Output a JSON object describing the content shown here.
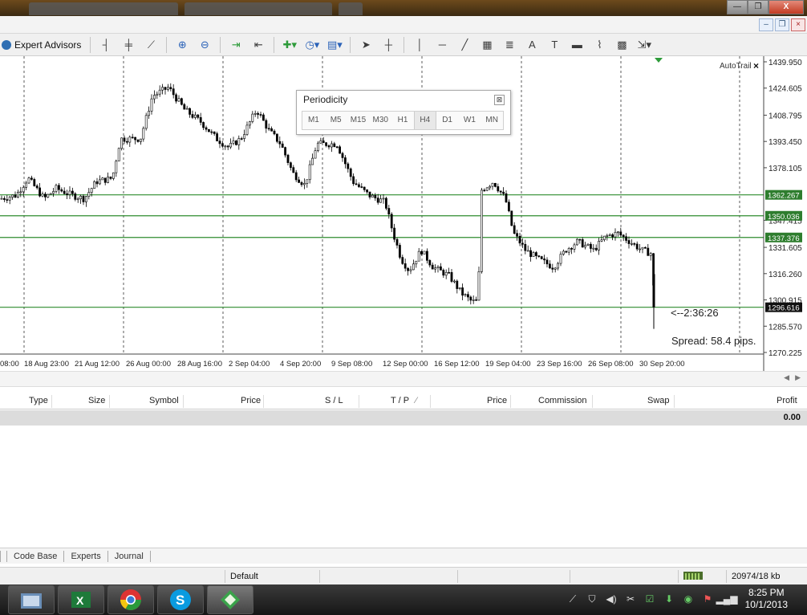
{
  "window": {
    "minimize": "—",
    "restore": "❐",
    "close": "X"
  },
  "mdi": {
    "minimize": "–",
    "restore": "❐",
    "close": "×"
  },
  "toolbar": {
    "expert_advisors": "Expert Advisors"
  },
  "chart": {
    "autotrail_label": "AutoTrail",
    "countdown": "<--2:36:26",
    "spread": "Spread: 58.4 pips.",
    "price_labels": [
      "1439.950",
      "1424.605",
      "1408.795",
      "1393.450",
      "1378.105",
      "1347.415",
      "1331.605",
      "1316.260",
      "1300.915",
      "1285.570",
      "1270.225"
    ],
    "levels": [
      {
        "price": 1362.267,
        "label": "1362.267"
      },
      {
        "price": 1350.036,
        "label": "1350.036"
      },
      {
        "price": 1337.376,
        "label": "1337.376"
      },
      {
        "price": 1296.616,
        "label": "1296.616"
      }
    ],
    "date_labels": [
      "08:00",
      "18 Aug 23:00",
      "21 Aug 12:00",
      "26 Aug 00:00",
      "28 Aug 16:00",
      "2 Sep 04:00",
      "4 Sep 20:00",
      "9 Sep 08:00",
      "12 Sep 00:00",
      "16 Sep 12:00",
      "19 Sep 04:00",
      "23 Sep 16:00",
      "26 Sep 08:00",
      "30 Sep 20:00"
    ]
  },
  "periodicity": {
    "title": "Periodicity",
    "close": "⊠",
    "options": [
      "M1",
      "M5",
      "M15",
      "M30",
      "H1",
      "H4",
      "D1",
      "W1",
      "MN"
    ],
    "selected": "H4"
  },
  "terminal": {
    "columns": [
      "Type",
      "Size",
      "Symbol",
      "Price",
      "S / L",
      "T / P",
      "Price",
      "Commission",
      "Swap",
      "Profit"
    ],
    "total_profit": "0.00"
  },
  "tabs": [
    "Code Base",
    "Experts",
    "Journal"
  ],
  "status": {
    "profile": "Default",
    "traffic": "20974/18 kb"
  },
  "clock": {
    "time": "8:25 PM",
    "date": "10/1/2013"
  },
  "colors": {
    "level_line": "#2e8b2e",
    "level_label_bg": "#2e7d2e",
    "bid_label_bg": "#111111",
    "candles": "#000000"
  }
}
